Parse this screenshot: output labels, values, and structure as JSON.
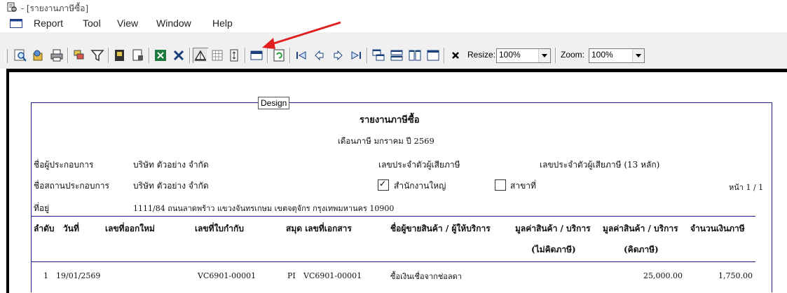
{
  "window": {
    "title": "- [รายงานภาษีซื้อ]"
  },
  "menu": {
    "items": [
      "Report",
      "Tool",
      "View",
      "Window",
      "Help"
    ]
  },
  "toolbar": {
    "resize_label": "Resize:",
    "resize_value": "100%",
    "zoom_label": "Zoom:",
    "zoom_value": "100%",
    "tooltip": "Design"
  },
  "report": {
    "title": "รายงานภาษีซื้อ",
    "period": "เดือนภาษี มกราคม ปี 2569",
    "operator_label": "ชื่อผู้ประกอบการ",
    "operator_value": "บริษัท ตัวอย่าง จำกัด",
    "taxid_label": "เลขประจำตัวผู้เสียภาษี",
    "taxid_note": "เลขประจำตัวผู้เสียภาษี (13 หลัก)",
    "branch_label": "ชื่อสถานประกอบการ",
    "branch_value": "บริษัท ตัวอย่าง จำกัด",
    "head_office": "สำนักงานใหญ่",
    "branch_option": "สาขาที่",
    "page": "หน้า 1 / 1",
    "address_label": "ที่อยู่",
    "address_value": "1111/84 ถนนลาดพร้าว แขวงจันทรเกษม เขตจตุจักร กรุงเทพมหานคร 10900",
    "columns": {
      "no": "ลำดับ",
      "date": "วันที่",
      "new_no": "เลขที่ออกใหม่",
      "invoice_no": "เลขที่ใบกำกับ",
      "book_doc": "สมุด เลขที่เอกสาร",
      "vendor": "ชื่อผู้ขายสินค้า / ผู้ให้บริการ",
      "value_excl": "มูลค่าสินค้า / บริการ",
      "value_excl_sub": "(ไม่คิดภาษี)",
      "value_incl": "มูลค่าสินค้า / บริการ",
      "value_incl_sub": "(คิดภาษี)",
      "tax": "จำนวนเงินภาษี"
    },
    "rows": [
      {
        "no": "1",
        "date": "19/01/2569",
        "invoice_no": "VC6901-00001",
        "book": "PI",
        "doc_no": "VC6901-00001",
        "vendor": "ซื้อเงินเชื่อจากช่อลดา",
        "value_incl": "25,000.00",
        "tax": "1,750.00"
      }
    ]
  }
}
